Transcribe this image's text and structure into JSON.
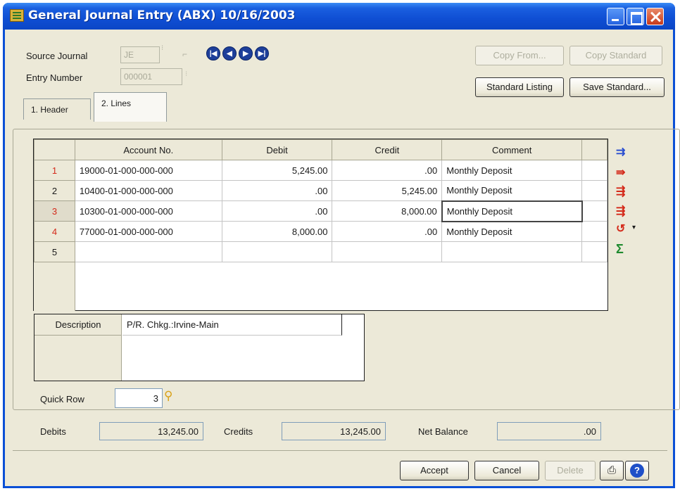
{
  "window": {
    "title": "General Journal Entry (ABX) 10/16/2003"
  },
  "header": {
    "source_journal_label": "Source Journal",
    "source_journal_value": "JE",
    "entry_number_label": "Entry Number",
    "entry_number_value": "000001",
    "copy_from_label": "Copy From...",
    "copy_standard_label": "Copy Standard",
    "standard_listing_label": "Standard Listing",
    "save_standard_label": "Save Standard..."
  },
  "tabs": [
    {
      "label": "1. Header"
    },
    {
      "label": "2. Lines"
    }
  ],
  "grid": {
    "columns": [
      "Account No.",
      "Debit",
      "Credit",
      "Comment"
    ],
    "rows": [
      {
        "num": "1",
        "account": "19000-01-000-000-000",
        "debit": "5,245.00",
        "credit": ".00",
        "comment": "Monthly Deposit"
      },
      {
        "num": "2",
        "account": "10400-01-000-000-000",
        "debit": ".00",
        "credit": "5,245.00",
        "comment": "Monthly Deposit"
      },
      {
        "num": "3",
        "account": "10300-01-000-000-000",
        "debit": ".00",
        "credit": "8,000.00",
        "comment": "Monthly Deposit"
      },
      {
        "num": "4",
        "account": "77000-01-000-000-000",
        "debit": "8,000.00",
        "credit": ".00",
        "comment": "Monthly Deposit"
      },
      {
        "num": "5",
        "account": "",
        "debit": "",
        "credit": "",
        "comment": ""
      }
    ]
  },
  "description": {
    "label": "Description",
    "value": "P/R. Chkg.:Irvine-Main"
  },
  "quick_row": {
    "label": "Quick Row",
    "value": "3"
  },
  "totals": {
    "debits_label": "Debits",
    "debits_value": "13,245.00",
    "credits_label": "Credits",
    "credits_value": "13,245.00",
    "net_balance_label": "Net Balance",
    "net_balance_value": ".00"
  },
  "footer": {
    "accept_label": "Accept",
    "cancel_label": "Cancel",
    "delete_label": "Delete"
  },
  "colors": {
    "titlebar": "#0b46c6",
    "row_number_red": "#d42a1a",
    "nav_buttons": "#1e3f9a"
  }
}
